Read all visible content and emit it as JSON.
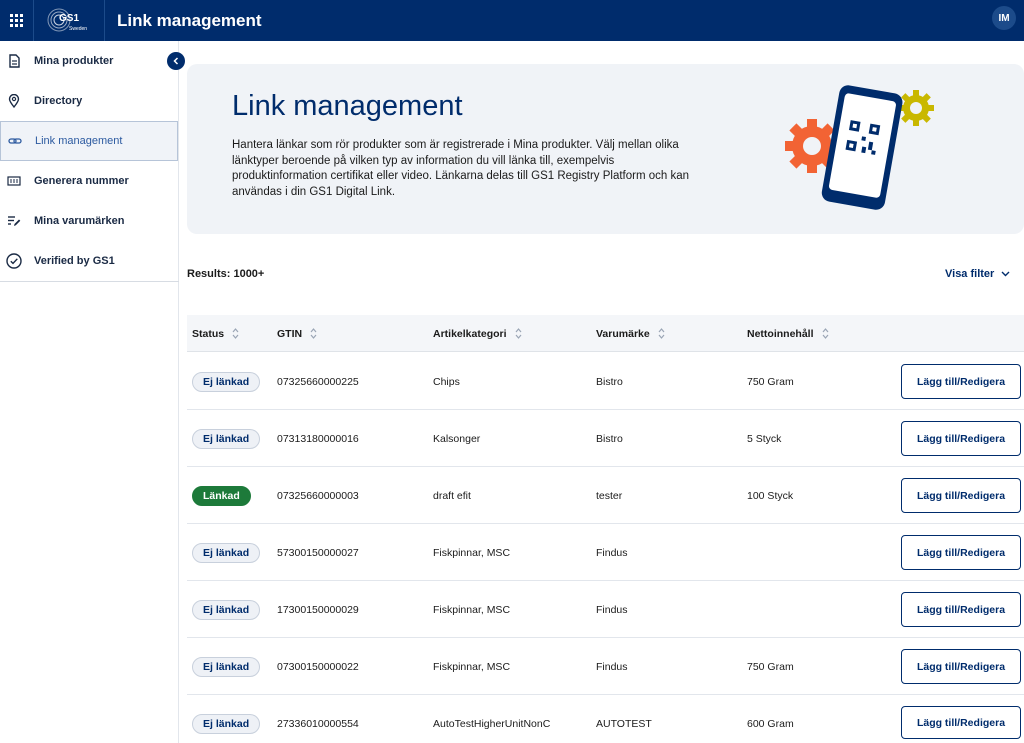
{
  "header": {
    "app_title": "Link management",
    "logo_text": "GS1",
    "logo_sub": "Sweden",
    "avatar_initials": "IM"
  },
  "sidebar": {
    "items": [
      {
        "label": "Mina produkter",
        "icon": "document-icon"
      },
      {
        "label": "Directory",
        "icon": "location-pin-icon"
      },
      {
        "label": "Link management",
        "icon": "link-icon",
        "active": true
      },
      {
        "label": "Generera nummer",
        "icon": "barcode-number-icon"
      },
      {
        "label": "Mina varumärken",
        "icon": "edit-list-icon"
      },
      {
        "label": "Verified by GS1",
        "icon": "check-circle-icon"
      }
    ]
  },
  "hero": {
    "title": "Link management",
    "text": "Hantera länkar som rör produkter som är registrerade i Mina produkter. Välj mellan olika länktyper beroende på vilken typ av information du vill länka till, exempelvis produktinformation certifikat eller video. Länkarna delas till GS1 Registry Platform och kan användas i din GS1 Digital Link."
  },
  "results_label": "Results: 1000+",
  "filter_label": "Visa filter",
  "table": {
    "columns": [
      "Status",
      "GTIN",
      "Artikelkategori",
      "Varumärke",
      "Nettoinnehåll"
    ],
    "button_label": "Lägg till/Redigera",
    "rows": [
      {
        "status": "Ej länkad",
        "linked": false,
        "gtin": "07325660000225",
        "category": "Chips",
        "brand": "Bistro",
        "net": "750 Gram"
      },
      {
        "status": "Ej länkad",
        "linked": false,
        "gtin": "07313180000016",
        "category": "Kalsonger",
        "brand": "Bistro",
        "net": "5 Styck"
      },
      {
        "status": "Länkad",
        "linked": true,
        "gtin": "07325660000003",
        "category": "draft efit",
        "brand": "tester",
        "net": "100 Styck"
      },
      {
        "status": "Ej länkad",
        "linked": false,
        "gtin": "57300150000027",
        "category": "Fiskpinnar, MSC",
        "brand": "Findus",
        "net": ""
      },
      {
        "status": "Ej länkad",
        "linked": false,
        "gtin": "17300150000029",
        "category": "Fiskpinnar, MSC",
        "brand": "Findus",
        "net": ""
      },
      {
        "status": "Ej länkad",
        "linked": false,
        "gtin": "07300150000022",
        "category": "Fiskpinnar, MSC",
        "brand": "Findus",
        "net": "750 Gram"
      },
      {
        "status": "Ej länkad",
        "linked": false,
        "gtin": "27336010000554",
        "category": "AutoTestHigherUnitNonC",
        "brand": "AUTOTEST",
        "net": "600 Gram"
      }
    ]
  },
  "colors": {
    "brand_navy": "#002c6c",
    "linked_green": "#1d7a3a",
    "gear_orange": "#f26334",
    "gear_yellow": "#c9b800"
  }
}
